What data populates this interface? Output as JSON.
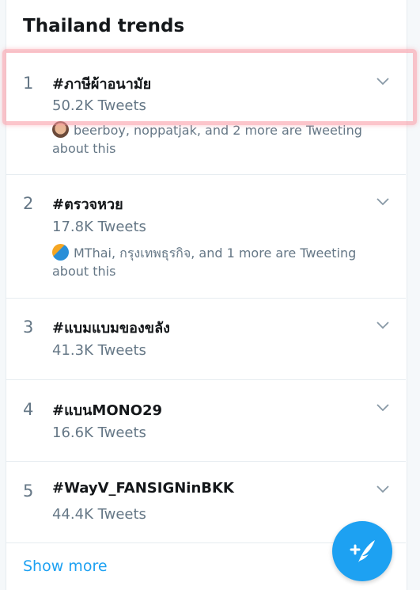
{
  "header": {
    "title": "Thailand trends"
  },
  "trends": [
    {
      "rank": "1",
      "tag": "#ภาษีผ้าอนามัย",
      "count": "50.2K Tweets",
      "context": "beerboy, noppatjak, and 2 more are Tweeting about this"
    },
    {
      "rank": "2",
      "tag": "#ตรวจหวย",
      "count": "17.8K Tweets",
      "context": "MThai, กรุงเทพธุรกิจ, and 1 more are Tweeting about this"
    },
    {
      "rank": "3",
      "tag": "#แบมแบมของขลัง",
      "count": "41.3K Tweets"
    },
    {
      "rank": "4",
      "tag": "#แบนMONO29",
      "count": "16.6K Tweets"
    },
    {
      "rank": "5",
      "tag": "#WayV_FANSIGNinBKK",
      "count": "44.4K Tweets"
    }
  ],
  "footer": {
    "show_more": "Show more"
  },
  "icons": {
    "chevron": "chevron-down-icon",
    "compose": "compose-tweet-icon",
    "avatar1": "avatar-icon",
    "avatar2": "mthai-avatar-icon"
  },
  "colors": {
    "accent": "#1da1f2",
    "text_primary": "#14171a",
    "text_secondary": "#657786",
    "highlight": "#fa96a0"
  }
}
